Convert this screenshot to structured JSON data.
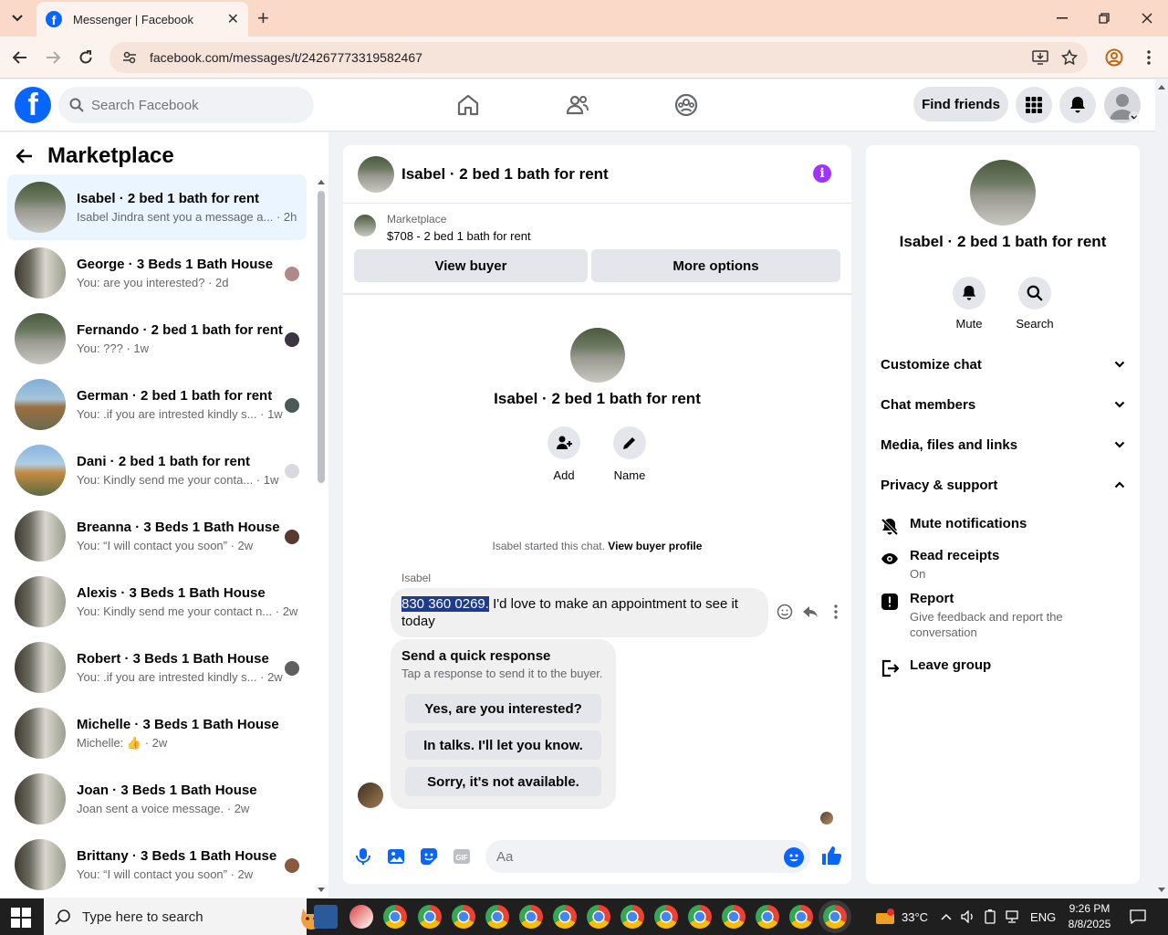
{
  "browser": {
    "tab_title": "Messenger | Facebook",
    "url": "facebook.com/messages/t/24267773319582467"
  },
  "fb": {
    "search_placeholder": "Search Facebook",
    "find_friends": "Find friends"
  },
  "sidebar": {
    "title": "Marketplace",
    "conversations": [
      {
        "name": "Isabel · 2 bed 1 bath for rent",
        "preview": "Isabel Jindra sent you a message a... · 2h",
        "active": true
      },
      {
        "name": "George · 3 Beds 1 Bath House",
        "preview": "You: are you interested? · 2d"
      },
      {
        "name": "Fernando · 2 bed 1 bath for rent",
        "preview": "You: ??? · 1w"
      },
      {
        "name": "German · 2 bed 1 bath for rent",
        "preview": "You: .if you are intrested kindly s... · 1w"
      },
      {
        "name": "Dani · 2 bed 1 bath for rent",
        "preview": "You: Kindly send me your conta... · 1w"
      },
      {
        "name": "Breanna · 3 Beds 1 Bath House",
        "preview": "You: “I will contact you soon” · 2w"
      },
      {
        "name": "Alexis · 3 Beds 1 Bath House",
        "preview": "You: Kindly send me your contact n... · 2w"
      },
      {
        "name": "Robert · 3 Beds 1 Bath House",
        "preview": "You: .if you are intrested kindly s... · 2w"
      },
      {
        "name": "Michelle · 3 Beds 1 Bath House",
        "preview": "Michelle: 👍 · 2w"
      },
      {
        "name": "Joan · 3 Beds 1 Bath House",
        "preview": "Joan sent a voice message. · 2w"
      },
      {
        "name": "Brittany · 3 Beds 1 Bath House",
        "preview": "You: “I will contact you soon” · 2w"
      }
    ]
  },
  "chat": {
    "title": "Isabel · 2 bed 1 bath for rent",
    "marketplace_label": "Marketplace",
    "listing": "$708 - 2 bed 1 bath for rent",
    "view_buyer": "View buyer",
    "more_options": "More options",
    "intro_name": "Isabel · 2 bed 1 bath for rent",
    "add_label": "Add",
    "name_label": "Name",
    "started_text": "Isabel started this chat.",
    "view_buyer_profile": "View buyer profile",
    "sender": "Isabel",
    "msg_highlight": "830 360 0269.",
    "msg_rest": " I'd love to make an appointment to see it today",
    "quick_title": "Send a quick response",
    "quick_sub": "Tap a response to send it to the buyer.",
    "quick_responses": [
      "Yes, are you interested?",
      "In talks. I'll let you know.",
      "Sorry, it's not available."
    ],
    "input_placeholder": "Aa"
  },
  "info": {
    "name": "Isabel · 2 bed 1 bath for rent",
    "mute": "Mute",
    "search": "Search",
    "sections": [
      "Customize chat",
      "Chat members",
      "Media, files and links",
      "Privacy & support"
    ],
    "mute_notifications": "Mute notifications",
    "read_receipts": "Read receipts",
    "read_receipts_state": "On",
    "report": "Report",
    "report_sub": "Give feedback and report the conversation",
    "leave_group": "Leave group"
  },
  "taskbar": {
    "search_placeholder": "Type here to search",
    "temperature": "33°C",
    "language": "ENG",
    "time": "9:26 PM",
    "date": "8/8/2025"
  }
}
